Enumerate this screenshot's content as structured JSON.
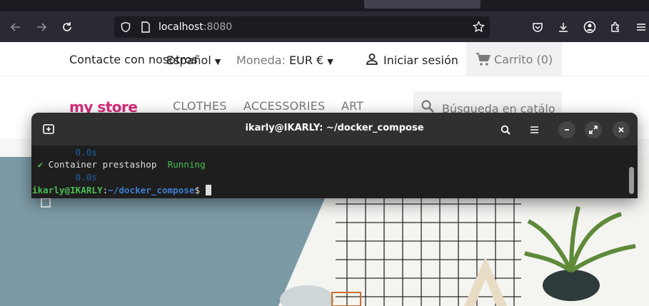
{
  "browser": {
    "url_host": "localhost",
    "url_port": ":8080"
  },
  "store": {
    "contact": "Contacte con nosotros",
    "language": "Español",
    "currency_label": "Moneda:",
    "currency_value": "EUR €",
    "signin": "Iniciar sesión",
    "cart": "Carrito (0)",
    "logo": "my store",
    "menu": [
      "CLOTHES",
      "ACCESSORIES",
      "ART"
    ],
    "search_placeholder": "Búsqueda en catálo"
  },
  "terminal": {
    "title": "ikarly@IKARLY: ~/docker_compose",
    "lines": {
      "time1": "0.0s",
      "check": "✔",
      "container": "Container prestashop",
      "status": "Running",
      "time2": "0.0s",
      "prompt_user": "ikarly@IKARLY",
      "prompt_sep": ":",
      "prompt_path": "~/docker_compose",
      "prompt_symbol": "$"
    }
  },
  "icons": {
    "back": "arrow-left-icon",
    "forward": "arrow-right-icon",
    "reload": "reload-icon",
    "shield": "shield-icon",
    "page": "page-icon",
    "bookmark": "star-icon",
    "pocket": "pocket-icon",
    "download": "download-icon",
    "account": "account-icon",
    "extensions": "puzzle-icon",
    "menu": "hamburger-icon",
    "user": "user-icon",
    "cart": "cart-icon",
    "search": "search-icon",
    "terminal_new_tab": "new-tab-icon",
    "terminal_search": "search-icon",
    "terminal_menu": "hamburger-icon",
    "terminal_min": "minimize-icon",
    "terminal_max": "maximize-icon",
    "terminal_close": "close-icon"
  },
  "colors": {
    "browser_bg": "#2b2a33",
    "terminal_bg": "#1e1e1e",
    "terminal_titlebar": "#303030",
    "prompt_green": "#4bbd57",
    "path_blue": "#3f7fd0",
    "hero_blue": "#7c9aa6"
  }
}
